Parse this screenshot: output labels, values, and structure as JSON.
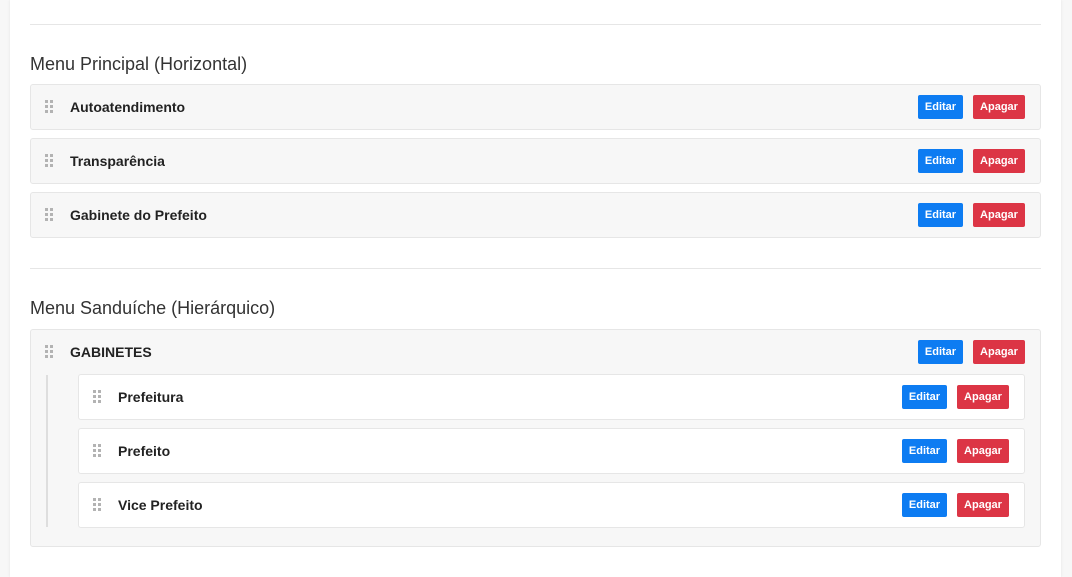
{
  "sections": {
    "horizontal": {
      "title": "Menu Principal (Horizontal)",
      "items": [
        {
          "label": "Autoatendimento"
        },
        {
          "label": "Transparência"
        },
        {
          "label": "Gabinete do Prefeito"
        }
      ]
    },
    "hierarchical": {
      "title": "Menu Sanduíche (Hierárquico)",
      "group": {
        "label": "GABINETES",
        "children": [
          {
            "label": "Prefeitura"
          },
          {
            "label": "Prefeito"
          },
          {
            "label": "Vice Prefeito"
          }
        ]
      }
    }
  },
  "actions": {
    "edit_label": "Editar",
    "delete_label": "Apagar"
  },
  "icons": {
    "drag_handle": "drag-handle-icon"
  },
  "colors": {
    "edit_button": "#0d7cf2",
    "delete_button": "#dc3545",
    "item_background": "#f7f7f7",
    "panel_background": "#ffffff"
  }
}
